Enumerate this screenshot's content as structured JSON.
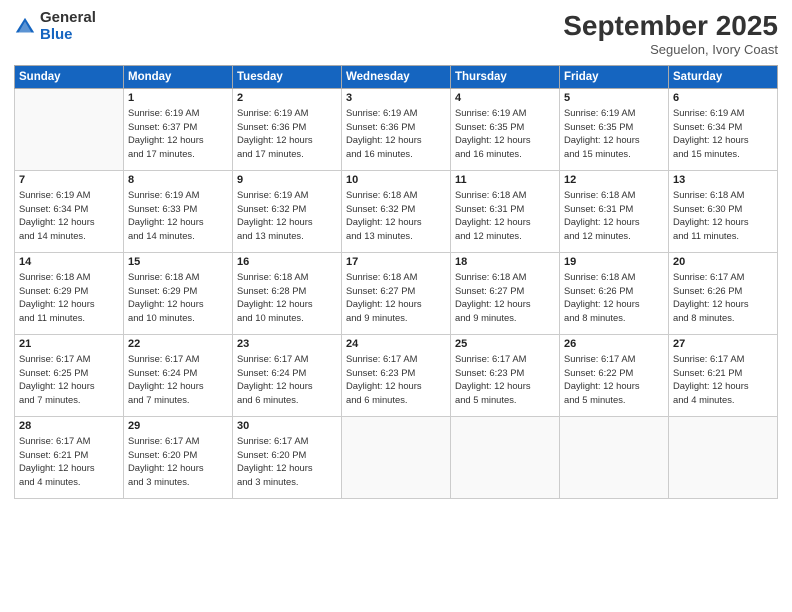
{
  "logo": {
    "general": "General",
    "blue": "Blue"
  },
  "title": "September 2025",
  "subtitle": "Seguelon, Ivory Coast",
  "days_header": [
    "Sunday",
    "Monday",
    "Tuesday",
    "Wednesday",
    "Thursday",
    "Friday",
    "Saturday"
  ],
  "weeks": [
    [
      {
        "day": "",
        "info": ""
      },
      {
        "day": "1",
        "info": "Sunrise: 6:19 AM\nSunset: 6:37 PM\nDaylight: 12 hours\nand 17 minutes."
      },
      {
        "day": "2",
        "info": "Sunrise: 6:19 AM\nSunset: 6:36 PM\nDaylight: 12 hours\nand 17 minutes."
      },
      {
        "day": "3",
        "info": "Sunrise: 6:19 AM\nSunset: 6:36 PM\nDaylight: 12 hours\nand 16 minutes."
      },
      {
        "day": "4",
        "info": "Sunrise: 6:19 AM\nSunset: 6:35 PM\nDaylight: 12 hours\nand 16 minutes."
      },
      {
        "day": "5",
        "info": "Sunrise: 6:19 AM\nSunset: 6:35 PM\nDaylight: 12 hours\nand 15 minutes."
      },
      {
        "day": "6",
        "info": "Sunrise: 6:19 AM\nSunset: 6:34 PM\nDaylight: 12 hours\nand 15 minutes."
      }
    ],
    [
      {
        "day": "7",
        "info": ""
      },
      {
        "day": "8",
        "info": "Sunrise: 6:19 AM\nSunset: 6:33 PM\nDaylight: 12 hours\nand 14 minutes."
      },
      {
        "day": "9",
        "info": "Sunrise: 6:19 AM\nSunset: 6:32 PM\nDaylight: 12 hours\nand 13 minutes."
      },
      {
        "day": "10",
        "info": "Sunrise: 6:18 AM\nSunset: 6:32 PM\nDaylight: 12 hours\nand 13 minutes."
      },
      {
        "day": "11",
        "info": "Sunrise: 6:18 AM\nSunset: 6:31 PM\nDaylight: 12 hours\nand 12 minutes."
      },
      {
        "day": "12",
        "info": "Sunrise: 6:18 AM\nSunset: 6:31 PM\nDaylight: 12 hours\nand 12 minutes."
      },
      {
        "day": "13",
        "info": "Sunrise: 6:18 AM\nSunset: 6:30 PM\nDaylight: 12 hours\nand 11 minutes."
      }
    ],
    [
      {
        "day": "14",
        "info": ""
      },
      {
        "day": "15",
        "info": "Sunrise: 6:18 AM\nSunset: 6:29 PM\nDaylight: 12 hours\nand 10 minutes."
      },
      {
        "day": "16",
        "info": "Sunrise: 6:18 AM\nSunset: 6:28 PM\nDaylight: 12 hours\nand 10 minutes."
      },
      {
        "day": "17",
        "info": "Sunrise: 6:18 AM\nSunset: 6:27 PM\nDaylight: 12 hours\nand 9 minutes."
      },
      {
        "day": "18",
        "info": "Sunrise: 6:18 AM\nSunset: 6:27 PM\nDaylight: 12 hours\nand 9 minutes."
      },
      {
        "day": "19",
        "info": "Sunrise: 6:18 AM\nSunset: 6:26 PM\nDaylight: 12 hours\nand 8 minutes."
      },
      {
        "day": "20",
        "info": "Sunrise: 6:17 AM\nSunset: 6:26 PM\nDaylight: 12 hours\nand 8 minutes."
      }
    ],
    [
      {
        "day": "21",
        "info": ""
      },
      {
        "day": "22",
        "info": "Sunrise: 6:17 AM\nSunset: 6:24 PM\nDaylight: 12 hours\nand 7 minutes."
      },
      {
        "day": "23",
        "info": "Sunrise: 6:17 AM\nSunset: 6:24 PM\nDaylight: 12 hours\nand 6 minutes."
      },
      {
        "day": "24",
        "info": "Sunrise: 6:17 AM\nSunset: 6:23 PM\nDaylight: 12 hours\nand 6 minutes."
      },
      {
        "day": "25",
        "info": "Sunrise: 6:17 AM\nSunset: 6:23 PM\nDaylight: 12 hours\nand 5 minutes."
      },
      {
        "day": "26",
        "info": "Sunrise: 6:17 AM\nSunset: 6:22 PM\nDaylight: 12 hours\nand 5 minutes."
      },
      {
        "day": "27",
        "info": "Sunrise: 6:17 AM\nSunset: 6:21 PM\nDaylight: 12 hours\nand 4 minutes."
      }
    ],
    [
      {
        "day": "28",
        "info": "Sunrise: 6:17 AM\nSunset: 6:21 PM\nDaylight: 12 hours\nand 4 minutes."
      },
      {
        "day": "29",
        "info": "Sunrise: 6:17 AM\nSunset: 6:20 PM\nDaylight: 12 hours\nand 3 minutes."
      },
      {
        "day": "30",
        "info": "Sunrise: 6:17 AM\nSunset: 6:20 PM\nDaylight: 12 hours\nand 3 minutes."
      },
      {
        "day": "",
        "info": ""
      },
      {
        "day": "",
        "info": ""
      },
      {
        "day": "",
        "info": ""
      },
      {
        "day": "",
        "info": ""
      }
    ]
  ],
  "week1_day7_info": "Sunrise: 6:19 AM\nSunset: 6:34 PM\nDaylight: 12 hours\nand 14 minutes.",
  "week3_day14_info": "Sunrise: 6:18 AM\nSunset: 6:29 PM\nDaylight: 12 hours\nand 11 minutes.",
  "week4_day21_info": "Sunrise: 6:17 AM\nSunset: 6:25 PM\nDaylight: 12 hours\nand 7 minutes."
}
